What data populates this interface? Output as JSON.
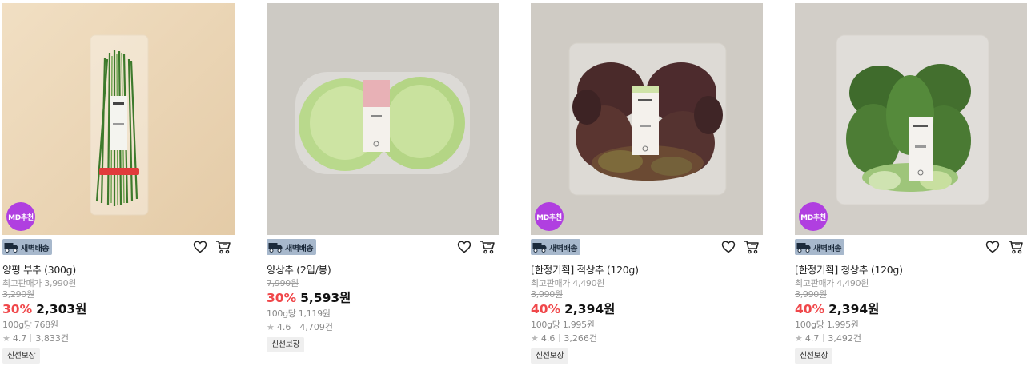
{
  "products": [
    {
      "name": "양평 부추 (300g)",
      "md_badge": "MD추천",
      "delivery_tag": "새벽배송",
      "max_price": "최고판매가 3,990원",
      "original_price": "3,290원",
      "discount": "30%",
      "sale_price": "2,303원",
      "unit_price": "100g당 768원",
      "rating": "4.7",
      "review_count": "3,833건",
      "fresh_tag": "신선보장",
      "image_icon": "chives-bundle-image"
    },
    {
      "name": "양상추 (2입/봉)",
      "md_badge": "",
      "delivery_tag": "새벽배송",
      "max_price": "",
      "original_price": "7,990원",
      "discount": "30%",
      "sale_price": "5,593원",
      "unit_price": "100g당 1,119원",
      "rating": "4.6",
      "review_count": "4,709건",
      "fresh_tag": "신선보장",
      "image_icon": "iceberg-lettuce-image"
    },
    {
      "name": "[한정기획] 적상추 (120g)",
      "md_badge": "MD추천",
      "delivery_tag": "새벽배송",
      "max_price": "최고판매가 4,490원",
      "original_price": "3,990원",
      "discount": "40%",
      "sale_price": "2,394원",
      "unit_price": "100g당 1,995원",
      "rating": "4.6",
      "review_count": "3,266건",
      "fresh_tag": "신선보장",
      "image_icon": "red-lettuce-image"
    },
    {
      "name": "[한정기획] 청상추 (120g)",
      "md_badge": "MD추천",
      "delivery_tag": "새벽배송",
      "max_price": "최고판매가 4,490원",
      "original_price": "3,990원",
      "discount": "40%",
      "sale_price": "2,394원",
      "unit_price": "100g당 1,995원",
      "rating": "4.7",
      "review_count": "3,492건",
      "fresh_tag": "신선보장",
      "image_icon": "green-lettuce-image"
    }
  ],
  "colors": {
    "discount": "#f0474a",
    "md_badge": "#b03fe0",
    "delivery_tag": "#a7b8cc"
  }
}
